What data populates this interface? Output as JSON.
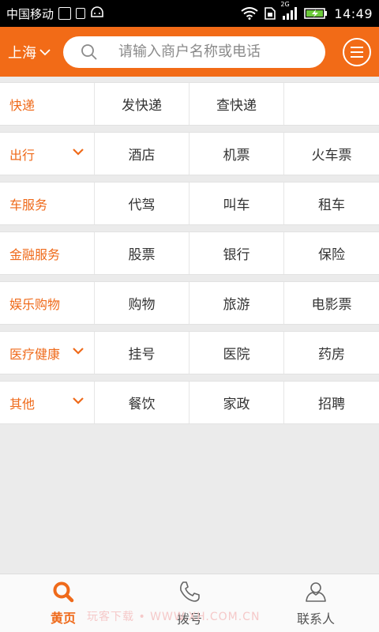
{
  "status_bar": {
    "carrier": "中国移动",
    "network": "2G",
    "time": "14:49"
  },
  "header": {
    "city": "上海",
    "search_placeholder": "请输入商户名称或电话"
  },
  "categories": [
    {
      "label": "快递",
      "has_chevron": false,
      "items": [
        "发快递",
        "查快递",
        ""
      ]
    },
    {
      "label": "出行",
      "has_chevron": true,
      "items": [
        "酒店",
        "机票",
        "火车票"
      ]
    },
    {
      "label": "车服务",
      "has_chevron": false,
      "items": [
        "代驾",
        "叫车",
        "租车"
      ]
    },
    {
      "label": "金融服务",
      "has_chevron": false,
      "items": [
        "股票",
        "银行",
        "保险"
      ]
    },
    {
      "label": "娱乐购物",
      "has_chevron": false,
      "items": [
        "购物",
        "旅游",
        "电影票"
      ]
    },
    {
      "label": "医疗健康",
      "has_chevron": true,
      "items": [
        "挂号",
        "医院",
        "药房"
      ]
    },
    {
      "label": "其他",
      "has_chevron": true,
      "items": [
        "餐饮",
        "家政",
        "招聘"
      ]
    }
  ],
  "bottom_nav": [
    {
      "label": "黄页",
      "icon": "search-icon",
      "active": true
    },
    {
      "label": "拨号",
      "icon": "phone-icon",
      "active": false
    },
    {
      "label": "联系人",
      "icon": "contact-icon",
      "active": false
    }
  ],
  "watermark": "玩客下载 • WWW.XH.COM.CN",
  "colors": {
    "accent": "#f26b17",
    "category_text": "#ef6a1a",
    "background": "#ebebeb"
  }
}
